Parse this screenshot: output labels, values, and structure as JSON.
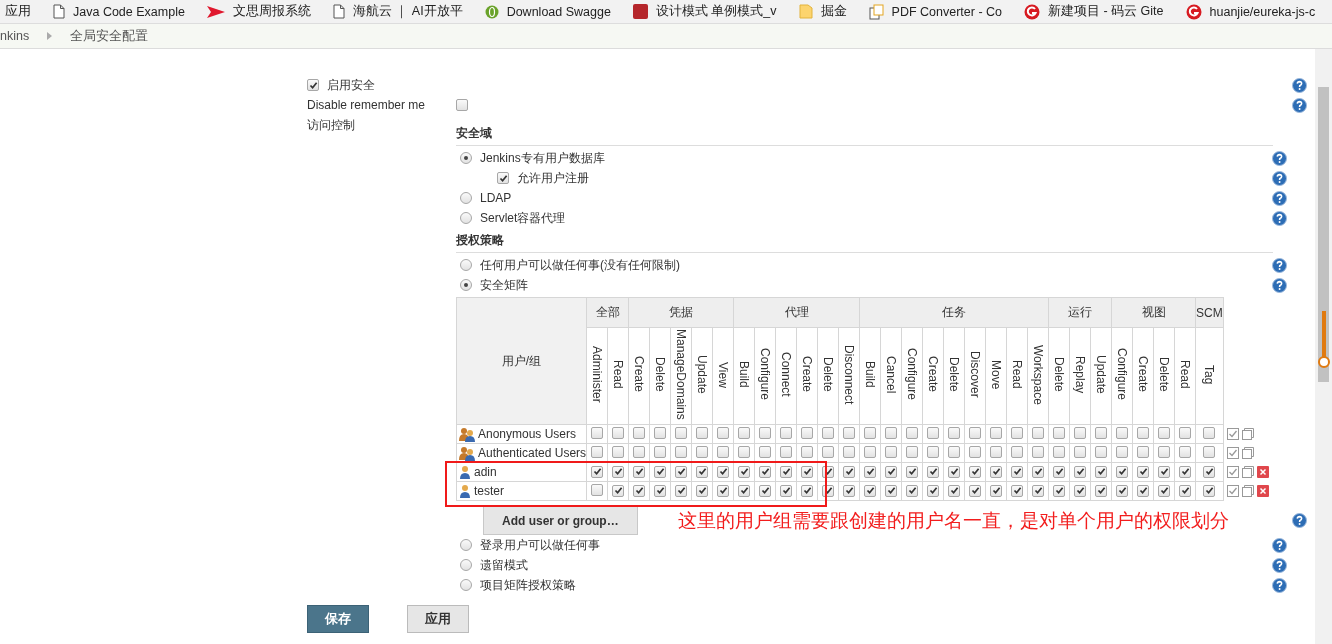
{
  "bookmarks": [
    {
      "label": "应用"
    },
    {
      "label": "Java Code Example"
    },
    {
      "label": "文思周报系统"
    },
    {
      "label": "海航云 ｜ AI开放平"
    },
    {
      "label": "Download Swagge"
    },
    {
      "label": "设计模式 单例模式_v"
    },
    {
      "label": "掘金"
    },
    {
      "label": "PDF Converter - Co"
    },
    {
      "label": "新建项目 - 码云 Gite"
    },
    {
      "label": "huanjie/eureka-js-c"
    }
  ],
  "breadcrumb": [
    "nkins",
    "全局安全配置"
  ],
  "enable_security": {
    "label": "启用安全",
    "checked": true
  },
  "disable_remember_me": {
    "label": "Disable remember me",
    "checked": false
  },
  "access_control": {
    "label": "访问控制"
  },
  "security_realm": {
    "title": "安全域",
    "options": [
      {
        "label": "Jenkins专有用户数据库",
        "selected": true,
        "sub_option": {
          "label": "允许用户注册",
          "checked": true
        }
      },
      {
        "label": "LDAP",
        "selected": false
      },
      {
        "label": "Servlet容器代理",
        "selected": false
      }
    ]
  },
  "authorization": {
    "title": "授权策略",
    "options": [
      {
        "label": "任何用户可以做任何事(没有任何限制)",
        "selected": false
      },
      {
        "label": "安全矩阵",
        "selected": true
      },
      {
        "label": "登录用户可以做任何事",
        "selected": false
      },
      {
        "label": "遗留模式",
        "selected": false
      },
      {
        "label": "项目矩阵授权策略",
        "selected": false
      }
    ]
  },
  "matrix": {
    "corner": "用户/组",
    "groups": [
      {
        "label": "全部",
        "permissions": [
          "Administer",
          "Read"
        ]
      },
      {
        "label": "凭据",
        "permissions": [
          "Create",
          "Delete",
          "ManageDomains",
          "Update",
          "View"
        ]
      },
      {
        "label": "代理",
        "permissions": [
          "Build",
          "Configure",
          "Connect",
          "Create",
          "Delete",
          "Disconnect"
        ]
      },
      {
        "label": "任务",
        "permissions": [
          "Build",
          "Cancel",
          "Configure",
          "Create",
          "Delete",
          "Discover",
          "Move",
          "Read",
          "Workspace"
        ]
      },
      {
        "label": "运行",
        "permissions": [
          "Delete",
          "Replay",
          "Update"
        ]
      },
      {
        "label": "视图",
        "permissions": [
          "Configure",
          "Create",
          "Delete",
          "Read"
        ]
      },
      {
        "label": "SCM",
        "permissions": [
          "Tag"
        ]
      }
    ],
    "rows": [
      {
        "name": "Anonymous Users",
        "kind": "group",
        "checked": [
          false,
          false,
          false,
          false,
          false,
          false,
          false,
          false,
          false,
          false,
          false,
          false,
          false,
          false,
          false,
          false,
          false,
          false,
          false,
          false,
          false,
          false,
          false,
          false,
          false,
          false,
          false,
          false,
          false,
          false
        ]
      },
      {
        "name": "Authenticated Users",
        "kind": "group",
        "checked": [
          false,
          false,
          false,
          false,
          false,
          false,
          false,
          false,
          false,
          false,
          false,
          false,
          false,
          false,
          false,
          false,
          false,
          false,
          false,
          false,
          false,
          false,
          false,
          false,
          false,
          false,
          false,
          false,
          false,
          false
        ]
      },
      {
        "name": "adin",
        "kind": "user",
        "checked": [
          true,
          true,
          true,
          true,
          true,
          true,
          true,
          true,
          true,
          true,
          true,
          true,
          true,
          true,
          true,
          true,
          true,
          true,
          true,
          true,
          true,
          true,
          true,
          true,
          true,
          true,
          true,
          true,
          true,
          true
        ]
      },
      {
        "name": "tester",
        "kind": "user",
        "checked": [
          false,
          true,
          true,
          true,
          true,
          true,
          true,
          true,
          true,
          true,
          true,
          true,
          true,
          true,
          true,
          true,
          true,
          true,
          true,
          true,
          true,
          true,
          true,
          true,
          true,
          true,
          true,
          true,
          true,
          true
        ]
      }
    ],
    "add_button": "Add user or group…"
  },
  "annotation": {
    "text": "这里的用户组需要跟创建的用户名一直，是对单个用户的权限划分"
  },
  "buttons": [
    {
      "label": "保存",
      "kind": "primary"
    },
    {
      "label": "应用",
      "kind": "secondary"
    }
  ]
}
